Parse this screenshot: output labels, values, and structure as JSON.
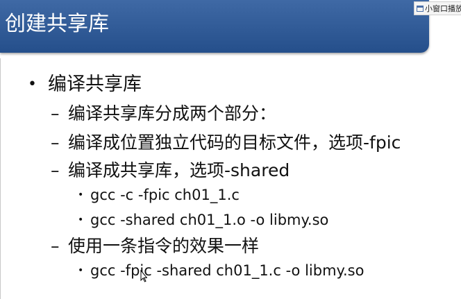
{
  "slide": {
    "title": "创建共享库"
  },
  "overlay": {
    "mini_window_label": "小窗口播放"
  },
  "bullets": {
    "level1_marker": "•",
    "level2_marker": "–",
    "level3_marker": "•",
    "heading": "编译共享库",
    "item1": "编译共享库分成两个部分：",
    "item2": "编译成位置独立代码的目标文件，选项-fpic",
    "item3": "编译成共享库，选项-shared",
    "cmd1": "gcc -c -fpic ch01_1.c",
    "cmd2": "gcc -shared ch01_1.o -o libmy.so",
    "item4": "使用一条指令的效果一样",
    "cmd3": "gcc -fpic -shared  ch01_1.c -o libmy.so"
  }
}
